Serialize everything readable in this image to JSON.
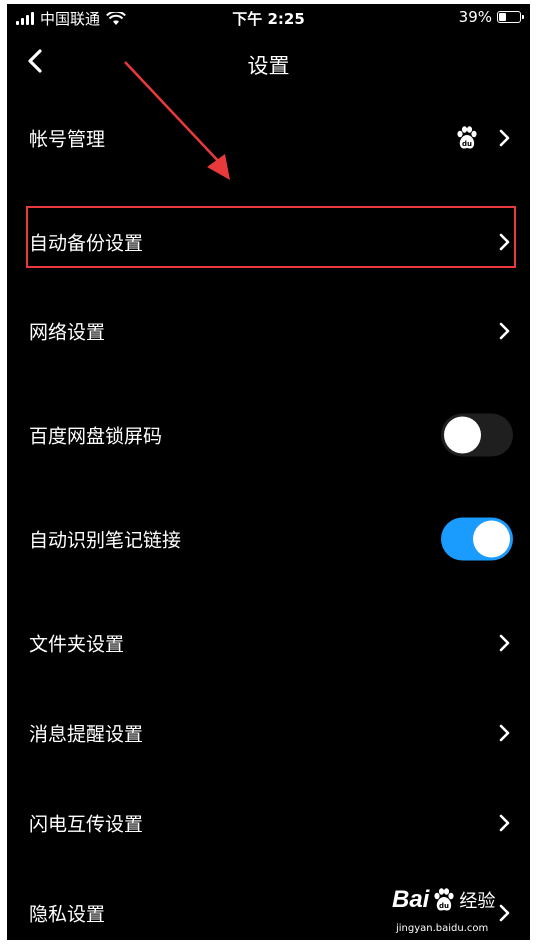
{
  "status_bar": {
    "carrier": "中国联通",
    "time": "下午 2:25",
    "battery_text": "39%",
    "battery_level": 0.39
  },
  "nav": {
    "title": "设置"
  },
  "settings": [
    {
      "label": "帐号管理"
    },
    {
      "label": "自动备份设置"
    },
    {
      "label": "网络设置"
    },
    {
      "label": "百度网盘锁屏码",
      "toggle": "off"
    },
    {
      "label": "自动识别笔记链接",
      "toggle": "on"
    },
    {
      "label": "文件夹设置"
    },
    {
      "label": "消息提醒设置"
    },
    {
      "label": "闪电互传设置"
    },
    {
      "label": "隐私设置"
    }
  ],
  "colors": {
    "background": "#000000",
    "toggle_on": "#1a9cff",
    "highlight": "#e83a3a"
  },
  "watermark": {
    "brand_a": "Bai",
    "brand_b": "du",
    "brand_c": "经验",
    "url": "jingyan.baidu.com"
  }
}
